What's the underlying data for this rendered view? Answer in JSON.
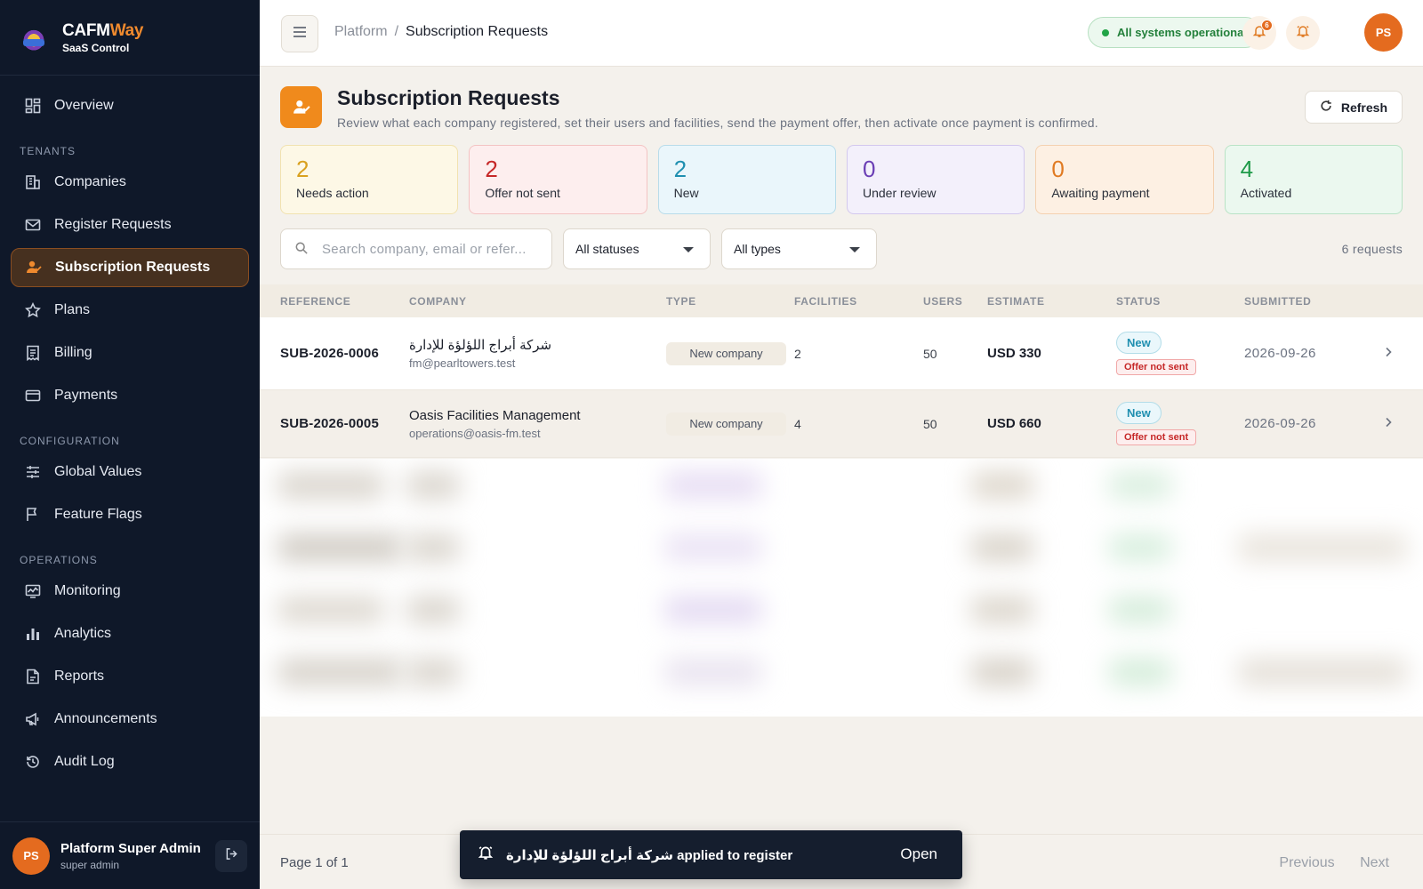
{
  "brand": {
    "name_main": "CAFM",
    "name_accent": "Way",
    "subtitle": "SaaS Control"
  },
  "sidebar": {
    "items_top": [
      {
        "label": "Overview",
        "icon": "grid-icon"
      }
    ],
    "sections": [
      {
        "title": "TENANTS",
        "items": [
          {
            "label": "Companies",
            "icon": "building-icon"
          },
          {
            "label": "Register Requests",
            "icon": "mail-icon"
          },
          {
            "label": "Subscription Requests",
            "icon": "user-check-icon",
            "active": true
          },
          {
            "label": "Plans",
            "icon": "star-icon"
          },
          {
            "label": "Billing",
            "icon": "receipt-icon"
          },
          {
            "label": "Payments",
            "icon": "card-icon"
          }
        ]
      },
      {
        "title": "CONFIGURATION",
        "items": [
          {
            "label": "Global Values",
            "icon": "sliders-icon"
          },
          {
            "label": "Feature Flags",
            "icon": "flag-icon"
          }
        ]
      },
      {
        "title": "OPERATIONS",
        "items": [
          {
            "label": "Monitoring",
            "icon": "monitor-icon"
          },
          {
            "label": "Analytics",
            "icon": "bar-chart-icon"
          },
          {
            "label": "Reports",
            "icon": "report-icon"
          },
          {
            "label": "Announcements",
            "icon": "megaphone-icon"
          },
          {
            "label": "Audit Log",
            "icon": "history-icon"
          }
        ]
      }
    ],
    "user": {
      "initials": "PS",
      "name": "Platform Super Admin",
      "role": "super admin"
    }
  },
  "topbar": {
    "breadcrumb": {
      "root": "Platform",
      "sep": "/",
      "current": "Subscription Requests"
    },
    "status_text": "All systems operational",
    "notif_count": "6",
    "avatar_initials": "PS"
  },
  "header": {
    "title": "Subscription Requests",
    "description": "Review what each company registered, set their users and facilities, send the payment offer, then activate once payment is confirmed.",
    "refresh_label": "Refresh"
  },
  "stats": [
    {
      "value": "2",
      "label": "Needs action",
      "color": "#d9a11f",
      "bg": "#fdf8e6",
      "border": "#f1e2b0"
    },
    {
      "value": "2",
      "label": "Offer not sent",
      "color": "#c62828",
      "bg": "#fdeeee",
      "border": "#f3c3c3"
    },
    {
      "value": "2",
      "label": "New",
      "color": "#1f8fb0",
      "bg": "#eaf6fb",
      "border": "#b8dcea"
    },
    {
      "value": "0",
      "label": "Under review",
      "color": "#6b3fb5",
      "bg": "#f3f0fb",
      "border": "#d3c8ee"
    },
    {
      "value": "0",
      "label": "Awaiting payment",
      "color": "#e07a22",
      "bg": "#fdf0e3",
      "border": "#f4d1b0"
    },
    {
      "value": "4",
      "label": "Activated",
      "color": "#1e9a48",
      "bg": "#ebf8ef",
      "border": "#b9e3c6"
    }
  ],
  "filters": {
    "search_placeholder": "Search company, email or refer...",
    "status_select": "All statuses",
    "type_select": "All types",
    "count_text": "6 requests"
  },
  "table": {
    "columns": [
      "REFERENCE",
      "COMPANY",
      "TYPE",
      "FACILITIES",
      "USERS",
      "ESTIMATE",
      "STATUS",
      "SUBMITTED"
    ],
    "rows": [
      {
        "reference": "SUB-2026-0006",
        "company": "شركة أبراج اللؤلؤة للإدارة",
        "email": "fm@pearltowers.test",
        "type": "New company",
        "facilities": "2",
        "users": "50",
        "estimate": "USD 330",
        "status": "New",
        "substatus": "Offer not sent",
        "submitted": "2026-09-26"
      },
      {
        "reference": "SUB-2026-0005",
        "company": "Oasis Facilities Management",
        "email": "operations@oasis-fm.test",
        "type": "New company",
        "facilities": "4",
        "users": "50",
        "estimate": "USD 660",
        "status": "New",
        "substatus": "Offer not sent",
        "submitted": "2026-09-26"
      }
    ]
  },
  "footer": {
    "page_info": "Page 1 of 1",
    "prev": "Previous",
    "next": "Next"
  },
  "toast": {
    "message": "شركة أبراج اللؤلؤة للإدارة applied to register",
    "action": "Open"
  }
}
